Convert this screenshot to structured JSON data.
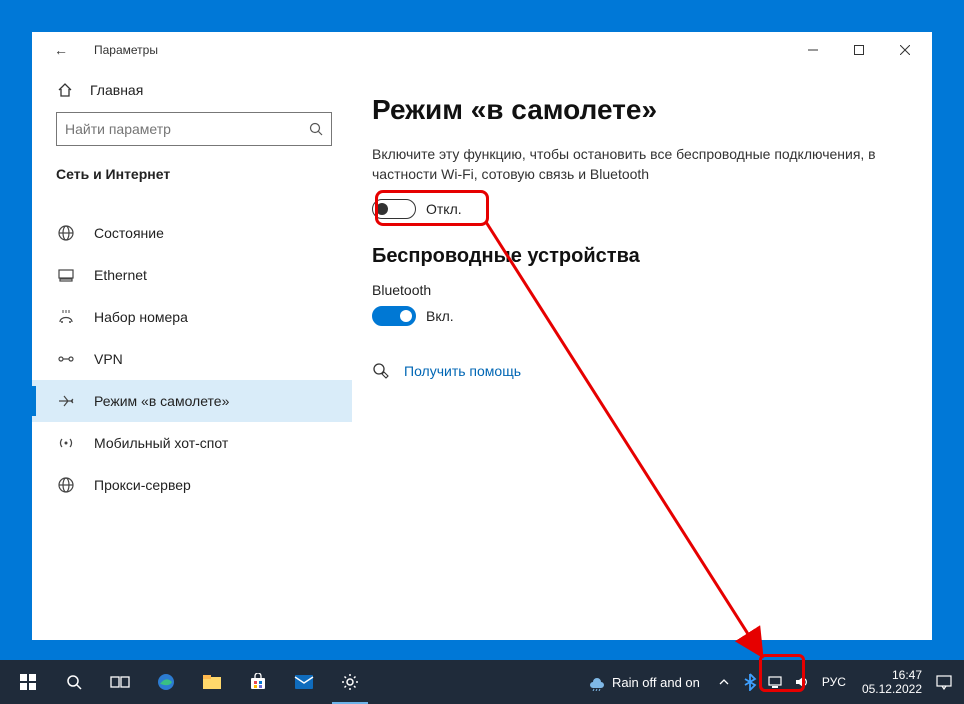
{
  "window": {
    "title": "Параметры",
    "controls": {
      "min": "—",
      "max": "▢",
      "close": "✕"
    }
  },
  "sidebar": {
    "home": "Главная",
    "search_placeholder": "Найти параметр",
    "section": "Сеть и Интернет",
    "items": [
      {
        "label": "Состояние",
        "icon": "globe"
      },
      {
        "label": "Ethernet",
        "icon": "ethernet"
      },
      {
        "label": "Набор номера",
        "icon": "dialup"
      },
      {
        "label": "VPN",
        "icon": "vpn"
      },
      {
        "label": "Режим «в самолете»",
        "icon": "airplane",
        "selected": true
      },
      {
        "label": "Мобильный хот-спот",
        "icon": "hotspot"
      },
      {
        "label": "Прокси-сервер",
        "icon": "proxy"
      }
    ]
  },
  "content": {
    "title": "Режим «в самолете»",
    "desc": "Включите эту функцию, чтобы остановить все беспроводные подключения, в частности Wi-Fi, сотовую связь и Bluetooth",
    "airplane_toggle_label": "Откл.",
    "wireless_title": "Беспроводные устройства",
    "bluetooth_label": "Bluetooth",
    "bluetooth_toggle_label": "Вкл.",
    "help_link": "Получить помощь"
  },
  "taskbar": {
    "weather": "Rain off and on",
    "lang": "РУС",
    "time": "16:47",
    "date": "05.12.2022"
  },
  "colors": {
    "accent": "#0078d4",
    "highlight": "#e60000"
  }
}
